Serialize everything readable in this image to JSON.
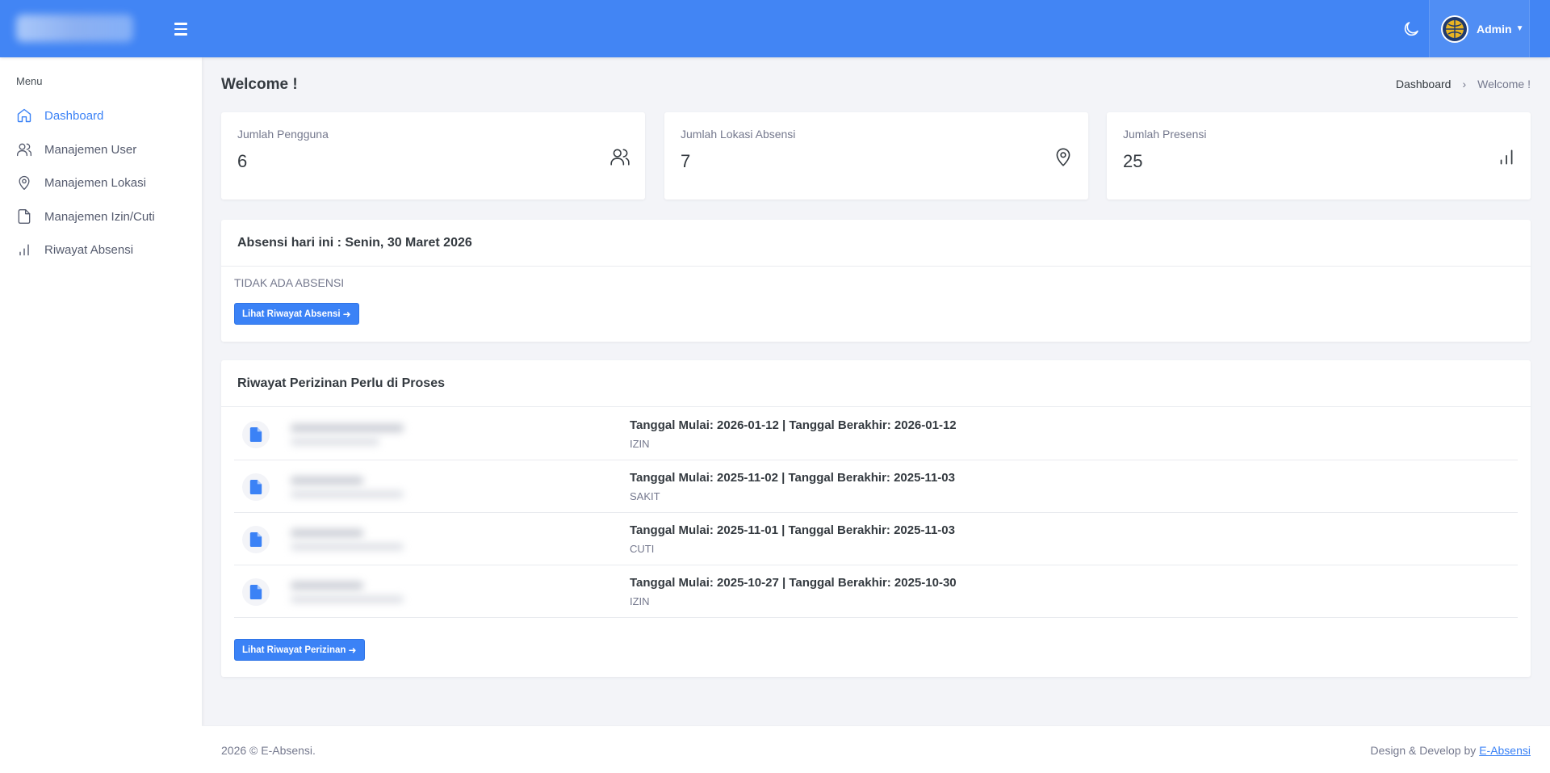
{
  "topbar": {
    "user_name": "Admin",
    "accent_color": "#4285f4",
    "icons": [
      "menu-icon",
      "moon-icon",
      "avatar-logo",
      "chevron-down-icon"
    ]
  },
  "sidebar": {
    "menu_title": "Menu",
    "items": [
      {
        "label": "Dashboard",
        "icon": "home-icon",
        "active": true
      },
      {
        "label": "Manajemen User",
        "icon": "users-icon",
        "active": false
      },
      {
        "label": "Manajemen Lokasi",
        "icon": "map-pin-icon",
        "active": false
      },
      {
        "label": "Manajemen Izin/Cuti",
        "icon": "file-icon",
        "active": false
      },
      {
        "label": "Riwayat Absensi",
        "icon": "bar-chart-icon",
        "active": false
      }
    ]
  },
  "page": {
    "title": "Welcome !",
    "breadcrumb": [
      "Dashboard",
      "Welcome !"
    ]
  },
  "stats": [
    {
      "label": "Jumlah Pengguna",
      "value": "6",
      "icon": "users-icon"
    },
    {
      "label": "Jumlah Lokasi Absensi",
      "value": "7",
      "icon": "map-pin-icon"
    },
    {
      "label": "Jumlah Presensi",
      "value": "25",
      "icon": "bar-chart-icon"
    }
  ],
  "attendance": {
    "title": "Absensi hari ini : Senin, 30 Maret 2026",
    "empty_text": "TIDAK ADA ABSENSI",
    "button_label": "Lihat Riwayat Absensi"
  },
  "permits": {
    "title": "Riwayat Perizinan Perlu di Proses",
    "rows": [
      {
        "dates": "Tanggal Mulai: 2026-01-12 | Tanggal Berakhir: 2026-01-12",
        "type": "IZIN"
      },
      {
        "dates": "Tanggal Mulai: 2025-11-02 | Tanggal Berakhir: 2025-11-03",
        "type": "SAKIT"
      },
      {
        "dates": "Tanggal Mulai: 2025-11-01 | Tanggal Berakhir: 2025-11-03",
        "type": "CUTI"
      },
      {
        "dates": "Tanggal Mulai: 2025-10-27 | Tanggal Berakhir: 2025-10-30",
        "type": "IZIN"
      }
    ],
    "button_label": "Lihat Riwayat Perizinan"
  },
  "footer": {
    "copyright": "2026 © E-Absensi.",
    "credit_prefix": "Design & Develop by",
    "credit_link": "E-Absensi"
  }
}
